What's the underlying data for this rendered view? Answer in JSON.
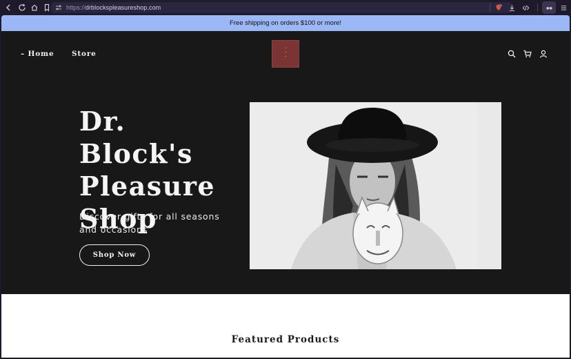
{
  "browser": {
    "url_protocol": "https://",
    "url_host": "drblockspleasureshop.com"
  },
  "announcement": {
    "text": "Free shipping on orders $100 or more!"
  },
  "header": {
    "nav": [
      {
        "label": "– Home"
      },
      {
        "label": "Store"
      }
    ],
    "icons": [
      "search-icon",
      "cart-icon",
      "account-icon"
    ]
  },
  "hero": {
    "title_line1": "Dr. Block's",
    "title_line2": "Pleasure",
    "title_line3": "Shop",
    "subtitle": "Discover gifts for all seasons and occasions",
    "button_label": "Shop Now"
  },
  "featured": {
    "title": "Featured Products"
  },
  "colors": {
    "announcement_bg": "#9bb7f5",
    "page_bg": "#191818",
    "logo_bg": "#7a3434"
  }
}
